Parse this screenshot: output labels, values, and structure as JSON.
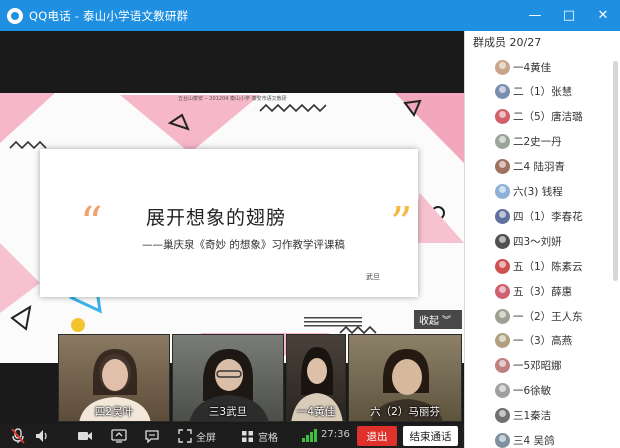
{
  "window": {
    "title": "QQ电话 - 泰山小学语文教研群",
    "controls": [
      "—",
      "□",
      "✕"
    ]
  },
  "slide": {
    "top_note": "五台山泰安 ·· 201204   泰山小学  泰安市语文教研",
    "title": "展开想象的翅膀",
    "subtitle": "——巢庆泉《奇妙 的想象》习作教学评课稿",
    "author": "武旦",
    "quote_open": "“",
    "quote_close": "”"
  },
  "collapse": {
    "label": "收起",
    "icon": "chevron-down-icon"
  },
  "participants": [
    {
      "name": "四2吴叶",
      "bg": "#6b5a45"
    },
    {
      "name": "三3武旦",
      "bg": "#5a5c58"
    },
    {
      "name": "一4黄佳",
      "bg": "#3a3430"
    },
    {
      "name": "六（2）马丽芬",
      "bg": "#7a7058"
    }
  ],
  "toolbar": {
    "mic_icon": "mic-muted-icon",
    "speaker_icon": "speaker-icon",
    "camera_icon": "camera-icon",
    "share_icon": "screen-share-icon",
    "chat_icon": "chat-icon",
    "fullscreen_label": "全屏",
    "grid_label": "宫格",
    "timer": "27:36",
    "exit_label": "退出",
    "end_label": "结束通话"
  },
  "panel": {
    "header": "群成员 20/27",
    "members": [
      {
        "name": "一4黄佳",
        "color": "#c9a48a"
      },
      {
        "name": "二（1）张慧",
        "color": "#7a8fb0"
      },
      {
        "name": "二（5）唐洁璐",
        "color": "#d0606a"
      },
      {
        "name": "二2史一丹",
        "color": "#9aa59a"
      },
      {
        "name": "二4 陆羽青",
        "color": "#a07060"
      },
      {
        "name": "六(3) 钱程",
        "color": "#8db0d8"
      },
      {
        "name": "四（1）李春花",
        "color": "#6070a0"
      },
      {
        "name": "四3～刘妍",
        "color": "#505050"
      },
      {
        "name": "五（1）陈素云",
        "color": "#d05050"
      },
      {
        "name": "五（3）薛惠",
        "color": "#d06070"
      },
      {
        "name": "一（2）王人东",
        "color": "#a0a090"
      },
      {
        "name": "一（3）高燕",
        "color": "#b0a080"
      },
      {
        "name": "一5邓昭娜",
        "color": "#c08080"
      },
      {
        "name": "一6徐敏",
        "color": "#a0a0a0"
      },
      {
        "name": "三1秦洁",
        "color": "#707070"
      },
      {
        "name": "三4 吴鸽",
        "color": "#8090a0"
      }
    ]
  }
}
